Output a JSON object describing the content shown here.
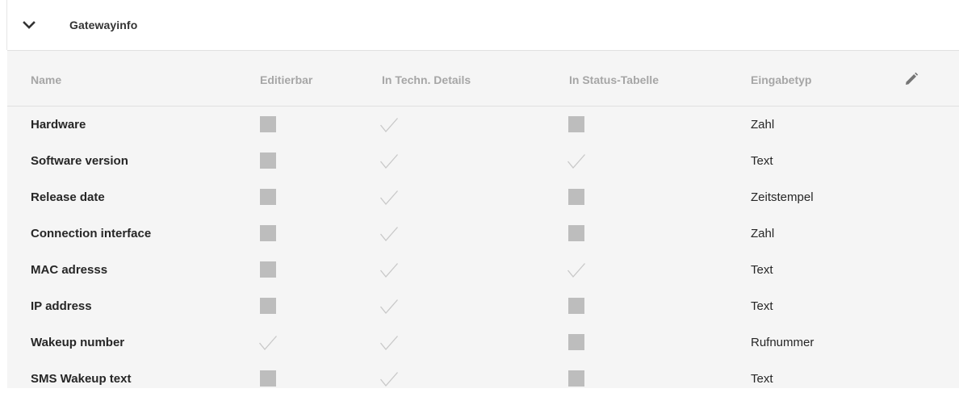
{
  "section": {
    "title": "Gatewayinfo",
    "expanded": true
  },
  "table": {
    "headers": {
      "name": "Name",
      "editable": "Editierbar",
      "tech_details": "In Techn. Details",
      "status_table": "In Status-Tabelle",
      "input_type": "Eingabetyp"
    },
    "rows": [
      {
        "name": "Hardware",
        "editable": false,
        "tech_details": true,
        "status_table": false,
        "input_type": "Zahl"
      },
      {
        "name": "Software version",
        "editable": false,
        "tech_details": true,
        "status_table": true,
        "input_type": "Text"
      },
      {
        "name": "Release date",
        "editable": false,
        "tech_details": true,
        "status_table": false,
        "input_type": "Zeitstempel"
      },
      {
        "name": "Connection interface",
        "editable": false,
        "tech_details": true,
        "status_table": false,
        "input_type": "Zahl"
      },
      {
        "name": "MAC adresss",
        "editable": false,
        "tech_details": true,
        "status_table": true,
        "input_type": "Text"
      },
      {
        "name": "IP address",
        "editable": false,
        "tech_details": true,
        "status_table": false,
        "input_type": "Text"
      },
      {
        "name": "Wakeup number",
        "editable": true,
        "tech_details": true,
        "status_table": false,
        "input_type": "Rufnummer"
      },
      {
        "name": "SMS Wakeup text",
        "editable": false,
        "tech_details": true,
        "status_table": false,
        "input_type": "Text"
      }
    ]
  },
  "icons": {
    "collapse": "chevron-down-icon",
    "edit": "pencil-icon"
  },
  "colors": {
    "header_text": "#a6a6a6",
    "body_text": "#262626",
    "unchecked_box": "#bdbdbd",
    "checkmark": "#c8c8c8",
    "table_background": "#f5f5f5"
  }
}
